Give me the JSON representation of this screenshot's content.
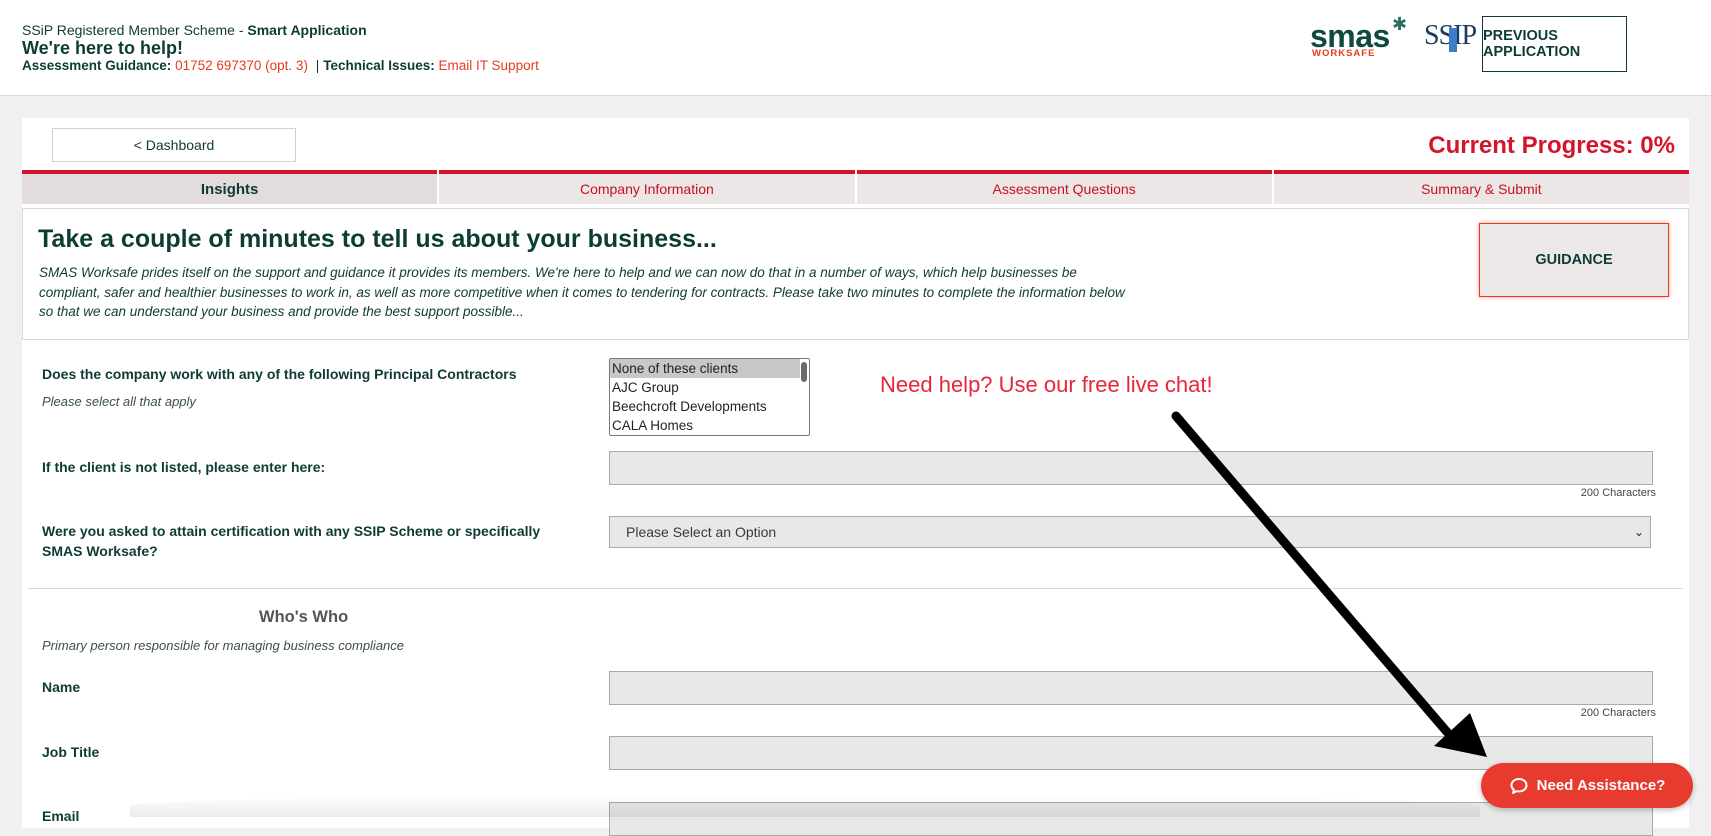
{
  "header": {
    "scheme_prefix": "SSiP Registered Member Scheme - ",
    "scheme_bold": "Smart Application",
    "help_title": "We're here to help!",
    "assessment_label": "Assessment Guidance:",
    "assessment_phone": "01752 697370 (opt. 3)",
    "separator": "|",
    "technical_label": "Technical Issues:",
    "technical_link": "Email IT Support",
    "logo_smas_word": "smas",
    "logo_smas_sub": "WORKSAFE",
    "logo_ssip": "SSIP",
    "previous_application": "PREVIOUS APPLICATION"
  },
  "nav": {
    "dashboard": "< Dashboard",
    "progress": "Current Progress: 0%",
    "tabs": [
      {
        "label": "Insights",
        "active": true
      },
      {
        "label": "Company Information",
        "active": false
      },
      {
        "label": "Assessment Questions",
        "active": false
      },
      {
        "label": "Summary & Submit",
        "active": false
      }
    ]
  },
  "intro": {
    "heading": "Take a couple of minutes to tell us about your business...",
    "body": "SMAS Worksafe prides itself on the support and guidance it provides its members. We're here to help and we can now do that in a number of ways, which help businesses be compliant, safer and healthier businesses to work in, as well as more competitive when it comes to tendering for contracts. Please take two minutes to complete the information below so that we can understand your business and provide the best support possible...",
    "guidance_button": "GUIDANCE"
  },
  "form": {
    "principal_label": "Does the company work with any of the following Principal Contractors",
    "principal_hint": "Please select all that apply",
    "principal_options": [
      "None of these clients",
      "AJC Group",
      "Beechcroft Developments",
      "CALA Homes"
    ],
    "client_label": "If the client is not listed, please enter here:",
    "char_limit": "200 Characters",
    "cert_label": "Were you asked to attain certification with any SSIP Scheme or specifically SMAS Worksafe?",
    "cert_placeholder": "Please Select an Option",
    "whos_who": "Who's Who",
    "whos_who_hint": "Primary person responsible for managing business compliance",
    "name_label": "Name",
    "job_title_label": "Job Title",
    "email_label": "Email"
  },
  "overlay": {
    "chat_cta": "Need help? Use our free live chat!",
    "assist_button": "Need Assistance?"
  },
  "colors": {
    "brand_green": "#0e3b35",
    "accent_red": "#d3142a",
    "link_orange": "#e63b1f"
  }
}
